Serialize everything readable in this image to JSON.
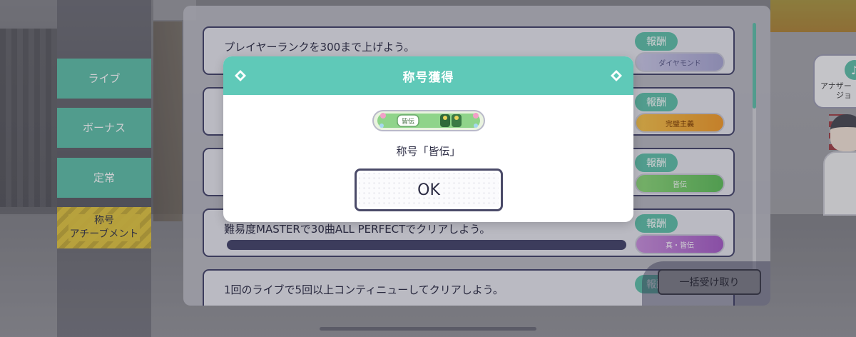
{
  "tabs": [
    {
      "label": "ライブ"
    },
    {
      "label": "ボーナス"
    },
    {
      "label": "定常"
    },
    {
      "label_line1": "称号",
      "label_line2": "アチーブメント"
    }
  ],
  "missions": [
    {
      "description": "プレイヤーランクを300まで上げよう。",
      "reward_badge": "報酬",
      "reward_plate": "ダイヤモンド"
    },
    {
      "description": "",
      "reward_badge": "報酬",
      "reward_plate": "完璧主義"
    },
    {
      "description": "",
      "reward_badge": "報酬",
      "reward_plate": "皆伝"
    },
    {
      "description": "難易度MASTERで30曲ALL PERFECTでクリアしよう。",
      "reward_badge": "報酬",
      "reward_plate": "真・皆伝",
      "progress": 1.0
    },
    {
      "description": "1回のライブで5回以上コンティニューしてクリアしよう。",
      "reward_badge": "報酬"
    }
  ],
  "bulk_receive_label": "一括受け取り",
  "another_label_line1": "アナザー",
  "another_label_line2": "ジョ",
  "modal": {
    "title": "称号獲得",
    "plate_text": "皆伝",
    "award_text": "称号「皆伝」",
    "ok_label": "OK"
  },
  "colors": {
    "accent_teal": "#5fc9b8",
    "tab_teal": "#5fbfa8",
    "achievement_yellow": "#e2c642",
    "navy": "#44446a"
  }
}
